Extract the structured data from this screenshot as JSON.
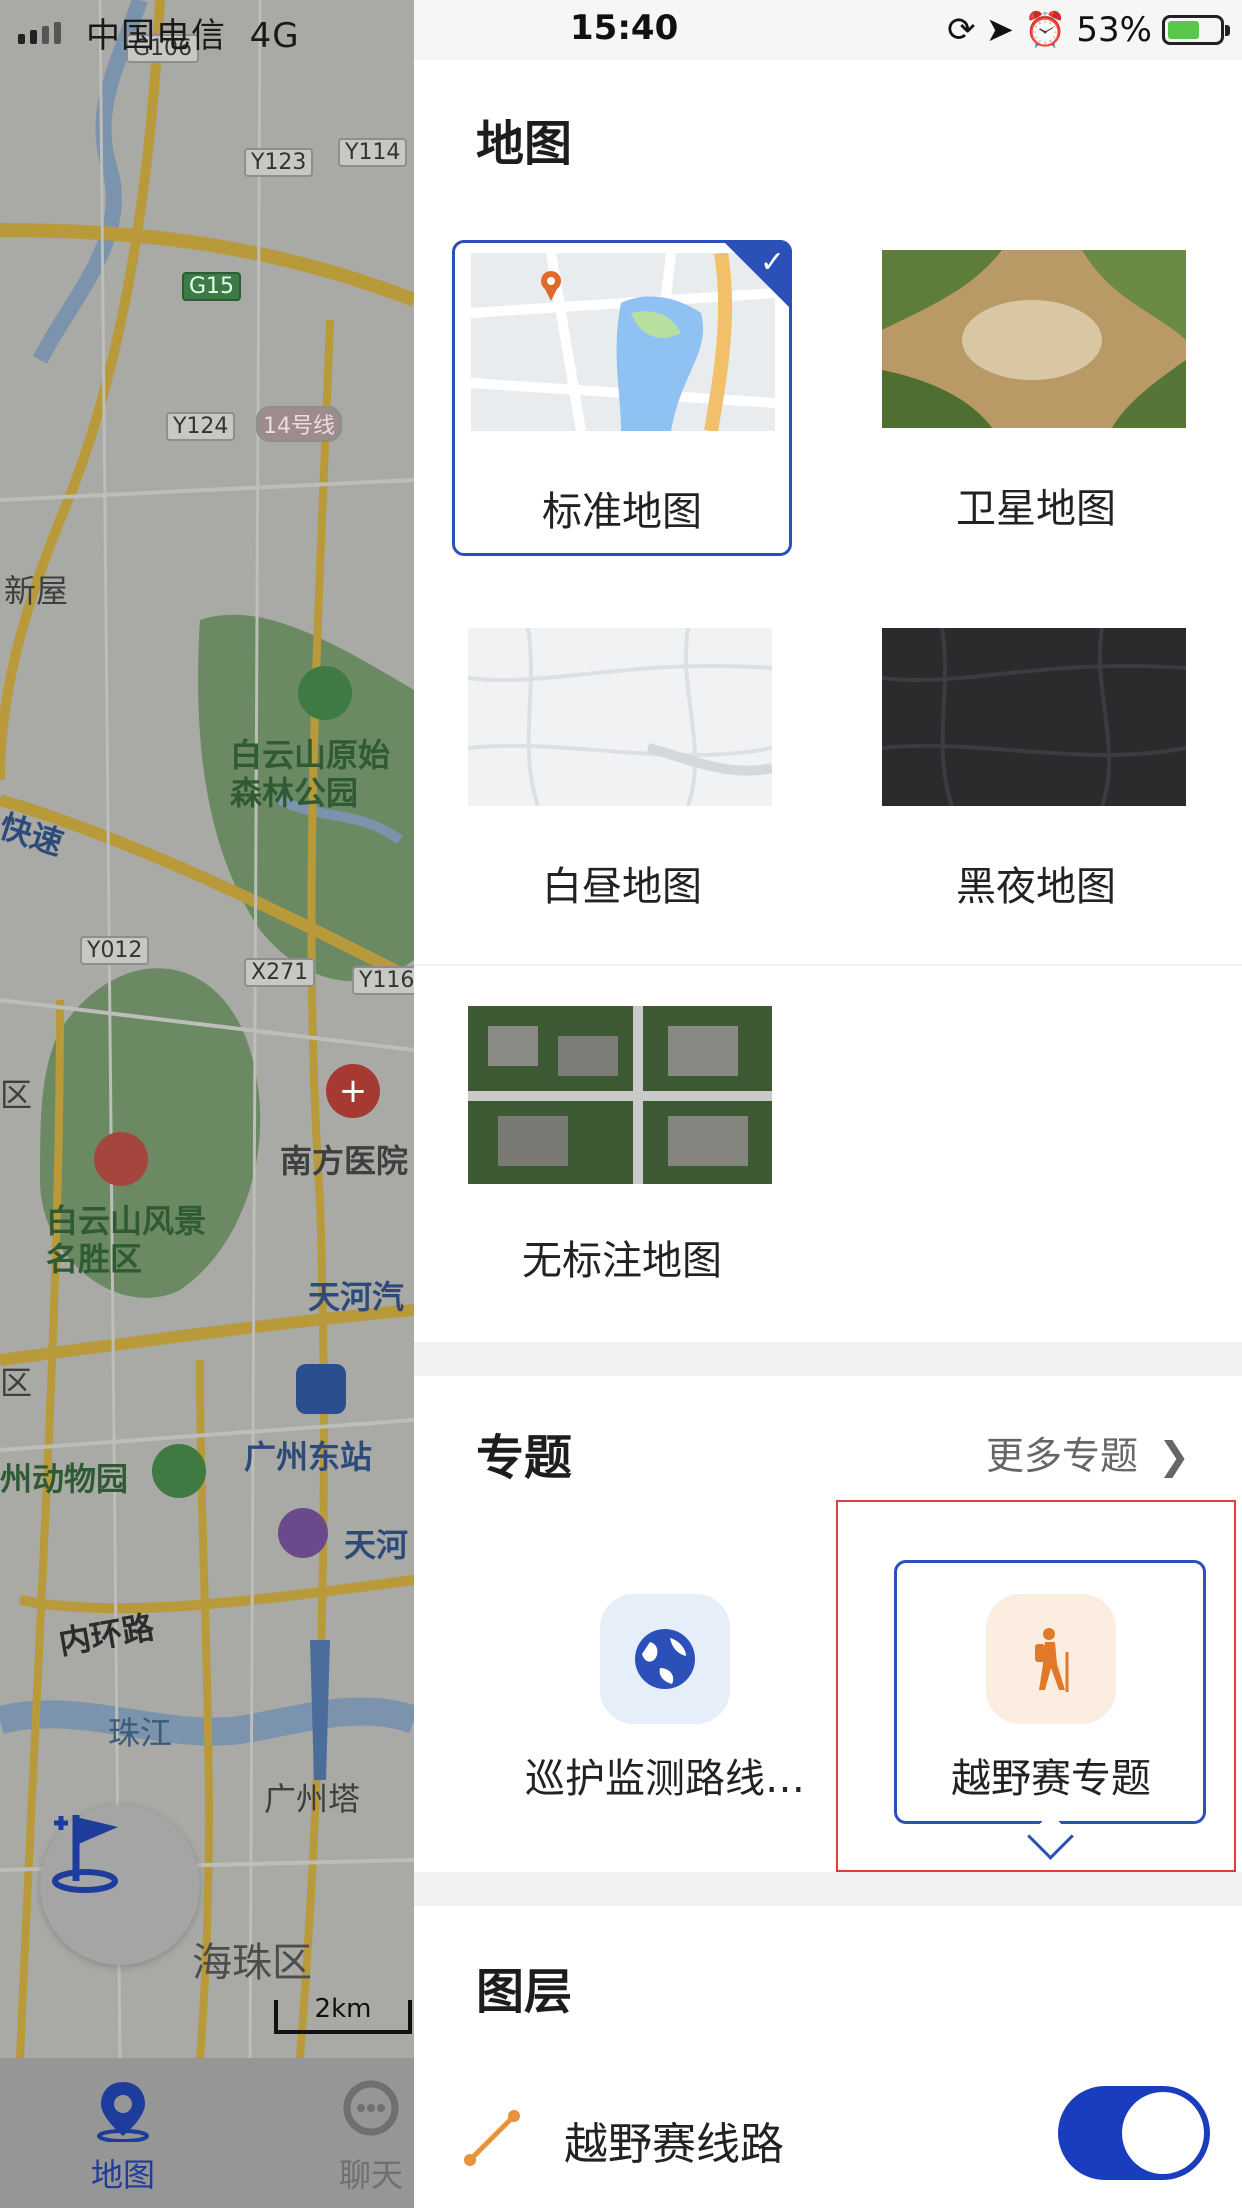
{
  "status_bar": {
    "carrier": "中国电信",
    "network": "4G",
    "time": "15:40",
    "battery": "53%"
  },
  "map": {
    "labels": {
      "xinwu": "新屋",
      "baiyun_forest": "白云山原始森林公园",
      "kuaisu": "快速",
      "nanfang": "南方医院",
      "baiyun_scenic": "白云山风景名胜区",
      "tianhe1": "天河汽",
      "guangzhou_east": "广州东站",
      "zoo": "州动物园",
      "tianhe2": "天河",
      "inner_ring": "内环路",
      "pearl_river": "珠江",
      "canton_tower": "广州塔",
      "haizhu": "海珠区",
      "qu1": "区",
      "qu2": "区"
    },
    "road_tags": [
      "G106",
      "Y123",
      "Y114",
      "G15",
      "Y124",
      "14号线",
      "Y012",
      "X271",
      "Y116"
    ],
    "scale": "2km"
  },
  "bottom_tabs": [
    {
      "label": "地图",
      "icon": "map-pin-icon",
      "color": "#1e3c9c"
    },
    {
      "label": "聊天",
      "icon": "chat-icon",
      "color": "#6f6f6f"
    }
  ],
  "panel": {
    "map_section_title": "地图",
    "map_types": [
      {
        "label": "标准地图",
        "selected": true
      },
      {
        "label": "卫星地图",
        "selected": false
      },
      {
        "label": "白昼地图",
        "selected": false
      },
      {
        "label": "黑夜地图",
        "selected": false
      },
      {
        "label": "无标注地图",
        "selected": false
      }
    ],
    "topics_title": "专题",
    "more_topics": "更多专题",
    "topics": [
      {
        "label": "巡护监测路线…",
        "icon": "globe-icon"
      },
      {
        "label": "越野赛专题",
        "icon": "hiker-icon",
        "selected": true
      }
    ],
    "layers_title": "图层",
    "layers": [
      {
        "label": "越野赛线路",
        "enabled": true
      }
    ]
  },
  "colors": {
    "accent": "#2b50b8",
    "toggle_on": "#1a3cbf",
    "highlight_border": "#e23b3b"
  }
}
